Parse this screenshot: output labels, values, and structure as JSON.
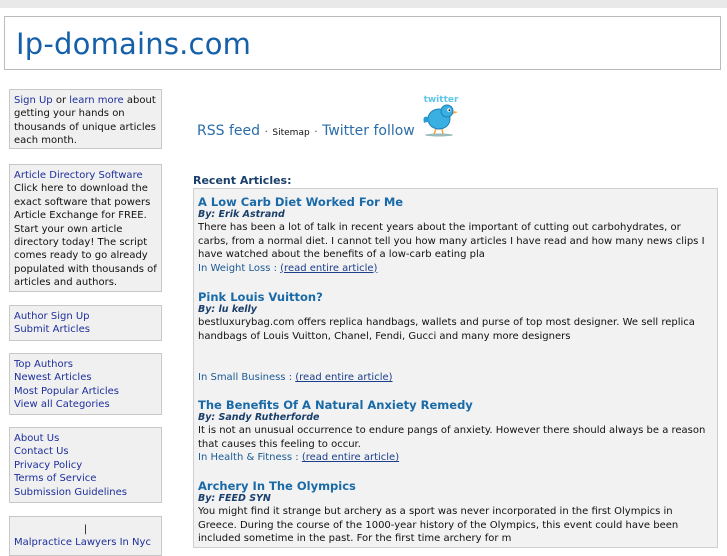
{
  "site": {
    "title": "Ip-domains.com"
  },
  "sidebar": {
    "signup_box": {
      "signup_link": "Sign Up",
      "or_text": "or",
      "learn_more_link": "learn more",
      "description": "about getting your hands on thousands of unique articles each month."
    },
    "software_box": {
      "title_link": "Article Directory Software",
      "description": "Click here to download the exact software that powers Article Exchange for FREE. Start your own article directory today! The script comes ready to go already populated with thousands of articles and authors."
    },
    "author_links": [
      "Author Sign Up",
      "Submit Articles"
    ],
    "browse_links": [
      "Top Authors",
      "Newest Articles",
      "Most Popular Articles",
      "View all Categories"
    ],
    "info_links": [
      "About Us",
      "Contact Us",
      "Privacy Policy",
      "Terms of Service",
      "Submission Guidelines"
    ],
    "promo": {
      "separator": "|",
      "link": "Malpractice Lawyers In Nyc"
    }
  },
  "feeds": {
    "rss": "RSS feed",
    "dot1": "·",
    "sitemap": "Sitemap",
    "dot2": "·",
    "twitter": "Twitter follow",
    "badge": "twitter"
  },
  "recent": {
    "heading": "Recent Articles:",
    "in_label": "In",
    "read_more": "(read entire article)",
    "items": [
      {
        "title": "A Low Carb Diet Worked For Me",
        "author": "By: Erik Astrand",
        "excerpt": "There has been a lot of talk in recent years about the important of cutting out carbohydrates, or carbs, from a normal diet. I cannot tell you how many articles I have read and how many news clips I have watched about the benefits of a low-carb eating pla",
        "category": "In Weight Loss :"
      },
      {
        "title": "Pink Louis Vuitton?",
        "author": "By: lu kelly",
        "excerpt": "bestluxurybag.com offers replica handbags, wallets and purse of top most designer. We sell replica handbags of Louis Vuitton, Chanel, Fendi, Gucci and many more designers",
        "category": "In Small Business :"
      },
      {
        "title": "The Benefits Of A Natural Anxiety Remedy",
        "author": "By: Sandy Rutherforde",
        "excerpt": "It is not an unusual occurrence to endure pangs of anxiety. However there should always be a reason that causes this feeling to occur.",
        "category": "In Health & Fitness :"
      },
      {
        "title": "Archery In The Olympics",
        "author": "By: FEED SYN",
        "excerpt": "You might find it strange but archery as a sport was never incorporated in the first Olympics in Greece. During the course of the 1000-year history of the Olympics, this event could have been included sometime in the past. For the first time archery for m",
        "category": ""
      }
    ]
  },
  "colors": {
    "title": "#1560a8",
    "link": "#1d2f9c",
    "heading": "#1b3f6b",
    "article_title": "#1a6aa8"
  }
}
